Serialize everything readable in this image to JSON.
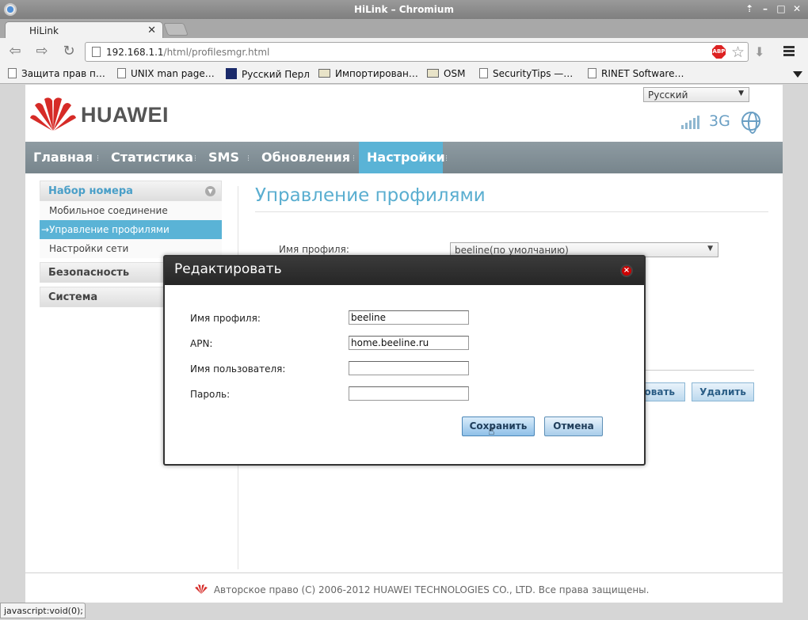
{
  "window": {
    "title": "HiLink – Chromium"
  },
  "tab": {
    "label": "HiLink"
  },
  "address": {
    "host": "192.168.1.1",
    "path": "/html/profilesmgr.html"
  },
  "bookmarks": [
    {
      "label": "Защита прав п…",
      "icon": "page-icon"
    },
    {
      "label": "UNIX man page…",
      "icon": "page-icon"
    },
    {
      "label": "Русский Перл",
      "icon": "perl-icon"
    },
    {
      "label": "Импортирован…",
      "icon": "folder-icon"
    },
    {
      "label": "OSM",
      "icon": "folder-icon"
    },
    {
      "label": "SecurityTips —…",
      "icon": "page-icon"
    },
    {
      "label": "RINET Software…",
      "icon": "page-icon"
    }
  ],
  "header": {
    "brand": "HUAWEI",
    "language": "Русский",
    "network_type": "3G"
  },
  "nav": [
    "Главная",
    "Статистика",
    "SMS",
    "Обновления",
    "Настройки"
  ],
  "sidebar": {
    "groups": [
      {
        "title": "Набор номера",
        "items": [
          "Мобильное соединение",
          "Управление профилями",
          "Настройки сети"
        ]
      },
      {
        "title": "Безопасность"
      },
      {
        "title": "Система"
      }
    ],
    "active_prefix": "→"
  },
  "content": {
    "title": "Управление профилями",
    "profile_label": "Имя профиля:",
    "profile_value": "beeline(по умолчанию)",
    "btn_edit_partial": "ровать",
    "btn_delete": "Удалить"
  },
  "dialog": {
    "title": "Редактировать",
    "fields": [
      {
        "label": "Имя профиля:",
        "value": "beeline"
      },
      {
        "label": "APN:",
        "value": "home.beeline.ru"
      },
      {
        "label": "Имя пользователя:",
        "value": ""
      },
      {
        "label": "Пароль:",
        "value": ""
      }
    ],
    "save": "Сохранить",
    "cancel": "Отмена"
  },
  "footer": {
    "copyright": "Авторское право (C) 2006-2012 HUAWEI TECHNOLOGIES CO., LTD. Все права защищены."
  },
  "statusbar": {
    "text": "javascript:void(0);"
  },
  "colors": {
    "accent": "#5ab3d6",
    "nav_bg": "#808e95",
    "huawei_red": "#d62b27"
  }
}
